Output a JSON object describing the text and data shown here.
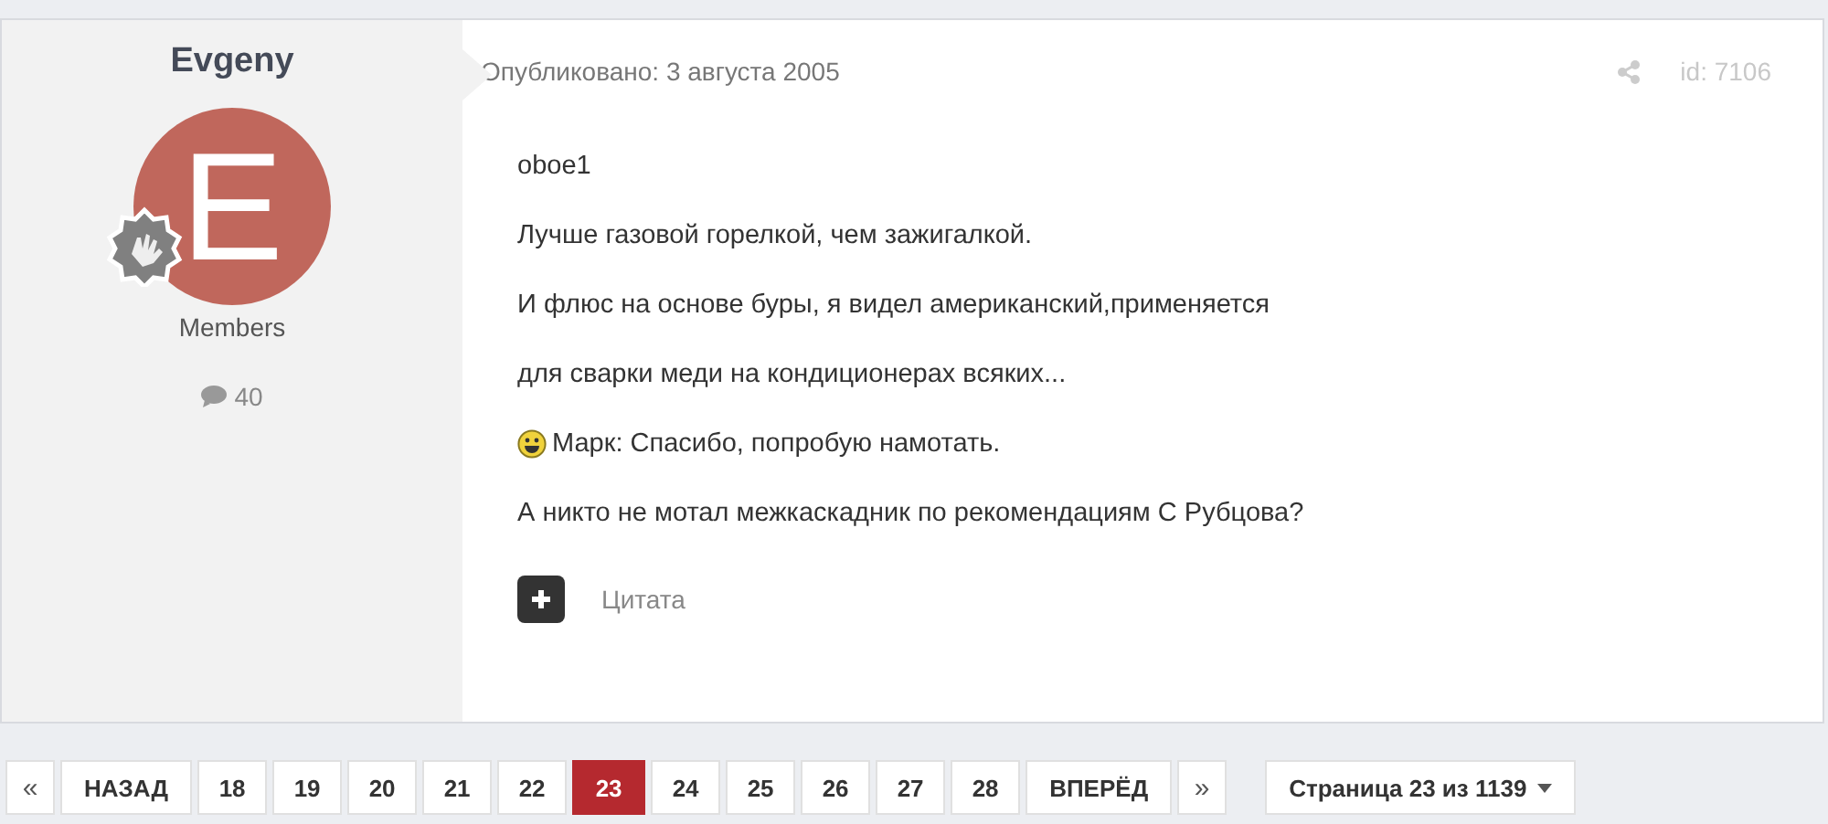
{
  "author": {
    "name": "Evgeny",
    "avatar_letter": "E",
    "group": "Members",
    "post_count": "40"
  },
  "post": {
    "published": "Опубликовано: 3 августа 2005",
    "id": "id: 7106",
    "paragraphs": [
      {
        "kind": "text",
        "text": "oboe1"
      },
      {
        "kind": "text",
        "text": "Лучше газовой горелкой, чем зажигалкой."
      },
      {
        "kind": "text",
        "text": "И флюс на основе буры, я видел американский,применяется"
      },
      {
        "kind": "text",
        "text": "для сварки меди на кондиционерах всяких..."
      },
      {
        "kind": "smiley",
        "text": "Марк: Спасибо, попробую намотать."
      },
      {
        "kind": "text",
        "text": "А никто не мотал межкаскадник по рекомендациям С Рубцова?"
      }
    ],
    "quote_label": "Цитата"
  },
  "pagination": {
    "items": [
      {
        "kind": "arrow",
        "label": "«",
        "selected": false
      },
      {
        "kind": "word",
        "label": "НАЗАД",
        "selected": false
      },
      {
        "kind": "page",
        "label": "18",
        "selected": false
      },
      {
        "kind": "page",
        "label": "19",
        "selected": false
      },
      {
        "kind": "page",
        "label": "20",
        "selected": false
      },
      {
        "kind": "page",
        "label": "21",
        "selected": false
      },
      {
        "kind": "page",
        "label": "22",
        "selected": false
      },
      {
        "kind": "page",
        "label": "23",
        "selected": true
      },
      {
        "kind": "page",
        "label": "24",
        "selected": false
      },
      {
        "kind": "page",
        "label": "25",
        "selected": false
      },
      {
        "kind": "page",
        "label": "26",
        "selected": false
      },
      {
        "kind": "page",
        "label": "27",
        "selected": false
      },
      {
        "kind": "page",
        "label": "28",
        "selected": false
      },
      {
        "kind": "word",
        "label": "ВПЕРЁД",
        "selected": false
      },
      {
        "kind": "arrow",
        "label": "»",
        "selected": false
      }
    ],
    "page_select": "Страница 23 из 1139"
  }
}
